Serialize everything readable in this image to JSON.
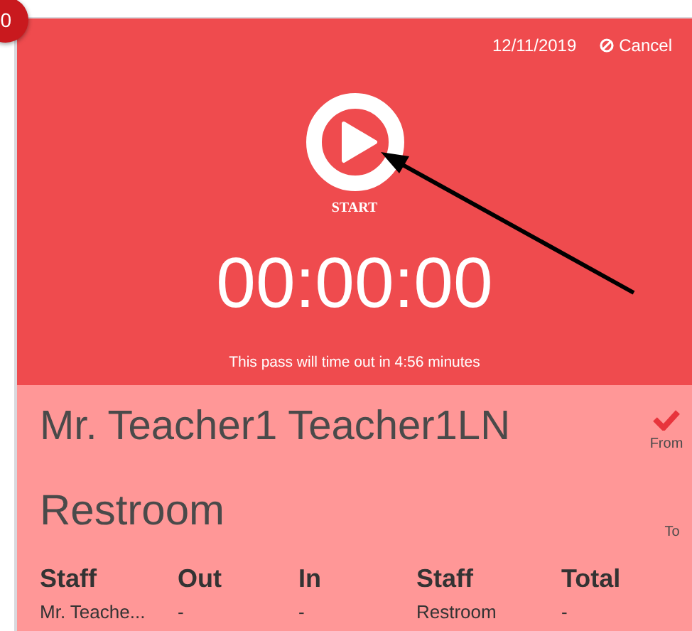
{
  "badge": "0",
  "header": {
    "date": "12/11/2019",
    "cancel": "Cancel"
  },
  "start_label": "START",
  "timer": "00:00:00",
  "timeout_notice": "This pass will time out in 4:56 minutes",
  "pass": {
    "name": "Mr. Teacher1 Teacher1LN",
    "destination": "Restroom",
    "from_label": "From",
    "from_checked": true,
    "to_label": "To"
  },
  "table": {
    "columns": [
      "Staff",
      "Out",
      "In",
      "Staff",
      "Total"
    ],
    "rows": [
      [
        "Mr. Teache...",
        "-",
        "-",
        "Restroom",
        "-"
      ]
    ]
  }
}
